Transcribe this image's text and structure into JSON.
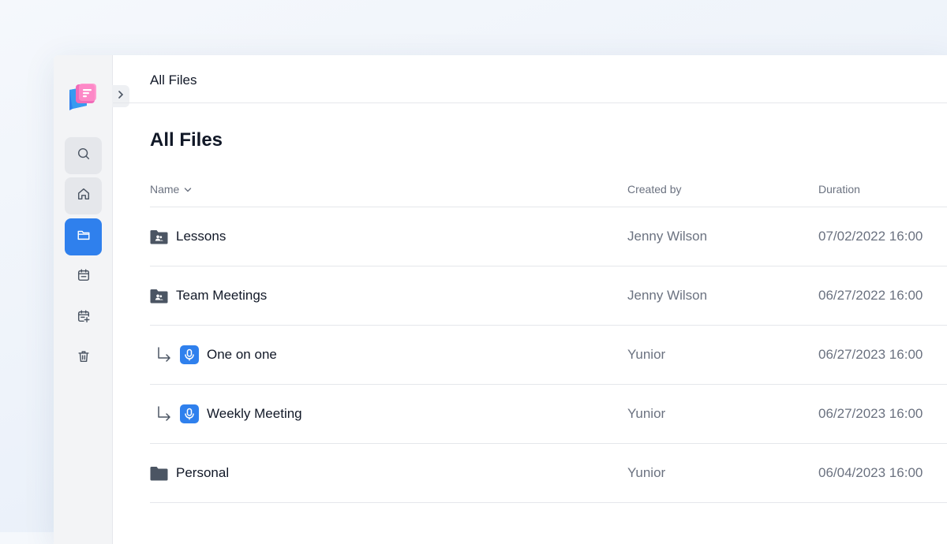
{
  "app": {
    "breadcrumb": "All Files",
    "page_title": "All Files"
  },
  "sidebar": {
    "items": [
      {
        "icon": "search-icon",
        "state": "hover"
      },
      {
        "icon": "home-icon",
        "state": "hover"
      },
      {
        "icon": "folder-icon",
        "state": "active"
      },
      {
        "icon": "calendar-icon",
        "state": "default"
      },
      {
        "icon": "calendar-add-icon",
        "state": "default"
      },
      {
        "icon": "trash-icon",
        "state": "default"
      }
    ]
  },
  "table": {
    "columns": {
      "name": "Name",
      "created_by": "Created by",
      "duration": "Duration"
    },
    "sort": {
      "column": "name",
      "direction": "desc"
    },
    "rows": [
      {
        "type": "shared-folder",
        "name": "Lessons",
        "created_by": "Jenny Wilson",
        "duration": "07/02/2022 16:00",
        "nested": false
      },
      {
        "type": "shared-folder",
        "name": "Team Meetings",
        "created_by": "Jenny Wilson",
        "duration": "06/27/2022 16:00",
        "nested": false
      },
      {
        "type": "recording",
        "name": "One on one",
        "created_by": "Yunior",
        "duration": "06/27/2023 16:00",
        "nested": true
      },
      {
        "type": "recording",
        "name": "Weekly Meeting",
        "created_by": "Yunior",
        "duration": "06/27/2023 16:00",
        "nested": true
      },
      {
        "type": "folder",
        "name": "Personal",
        "created_by": "Yunior",
        "duration": "06/04/2023 16:00",
        "nested": false
      }
    ]
  },
  "colors": {
    "accent": "#2f80ed",
    "folder": "#4b5563",
    "muted_text": "#6b7280"
  }
}
